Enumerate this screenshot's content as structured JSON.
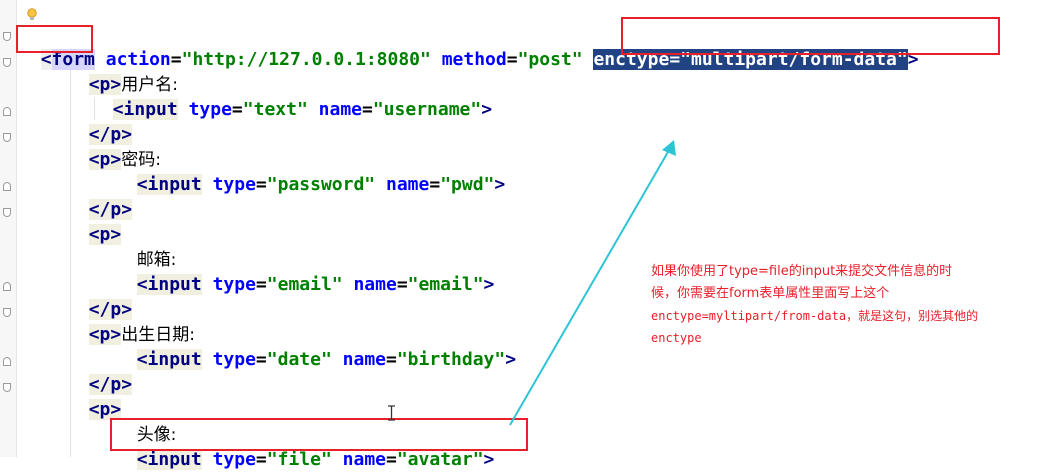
{
  "editor": {
    "lines": [
      {
        "open": "<",
        "tag": "form",
        "a1": "action",
        "v1": "\"http://127.0.0.1:8080\"",
        "a2": "method",
        "v2": "\"post\"",
        "a3": "enctype",
        "v3": "\"multipart/form-data\"",
        "close": ">"
      },
      {
        "open": "<",
        "tag": "p",
        "close": ">",
        "text": "用户名:"
      },
      {
        "open": "<",
        "tag": "input",
        "a1": "type",
        "v1": "\"text\"",
        "a2": "name",
        "v2": "\"username\"",
        "close": ">"
      },
      {
        "open": "</",
        "tag": "p",
        "close": ">"
      },
      {
        "open": "<",
        "tag": "p",
        "close": ">",
        "text": "密码:"
      },
      {
        "open": "<",
        "tag": "input",
        "a1": "type",
        "v1": "\"password\"",
        "a2": "name",
        "v2": "\"pwd\"",
        "close": ">"
      },
      {
        "open": "</",
        "tag": "p",
        "close": ">"
      },
      {
        "open": "<",
        "tag": "p",
        "close": ">"
      },
      {
        "text": "邮箱:"
      },
      {
        "open": "<",
        "tag": "input",
        "a1": "type",
        "v1": "\"email\"",
        "a2": "name",
        "v2": "\"email\"",
        "close": ">"
      },
      {
        "open": "</",
        "tag": "p",
        "close": ">"
      },
      {
        "open": "<",
        "tag": "p",
        "close": ">",
        "text": "出生日期:"
      },
      {
        "open": "<",
        "tag": "input",
        "a1": "type",
        "v1": "\"date\"",
        "a2": "name",
        "v2": "\"birthday\"",
        "close": ">"
      },
      {
        "open": "</",
        "tag": "p",
        "close": ">"
      },
      {
        "open": "<",
        "tag": "p",
        "close": ">"
      },
      {
        "text": "头像:"
      },
      {
        "open": "<",
        "tag": "input",
        "a1": "type",
        "v1": "\"file\"",
        "a2": "name",
        "v2": "\"avatar\"",
        "close": ">"
      }
    ]
  },
  "annotation": {
    "line1": "如果你使用了type=file的input来提交文件信息的时",
    "line2": "候，你需要在form表单属性里面写上这个",
    "line3": "enctype=myltipart/from-data，就是这句，别选其他的",
    "line4": "enctype"
  },
  "colors": {
    "highlight_box": "#e8202a",
    "arrow": "#2ec4d6",
    "tag": "#000080",
    "attribute": "#0000ff",
    "string": "#008000",
    "selection": "#214283"
  },
  "icons": {
    "gutter": "lightbulb-icon",
    "cursor": "text-cursor-icon"
  }
}
